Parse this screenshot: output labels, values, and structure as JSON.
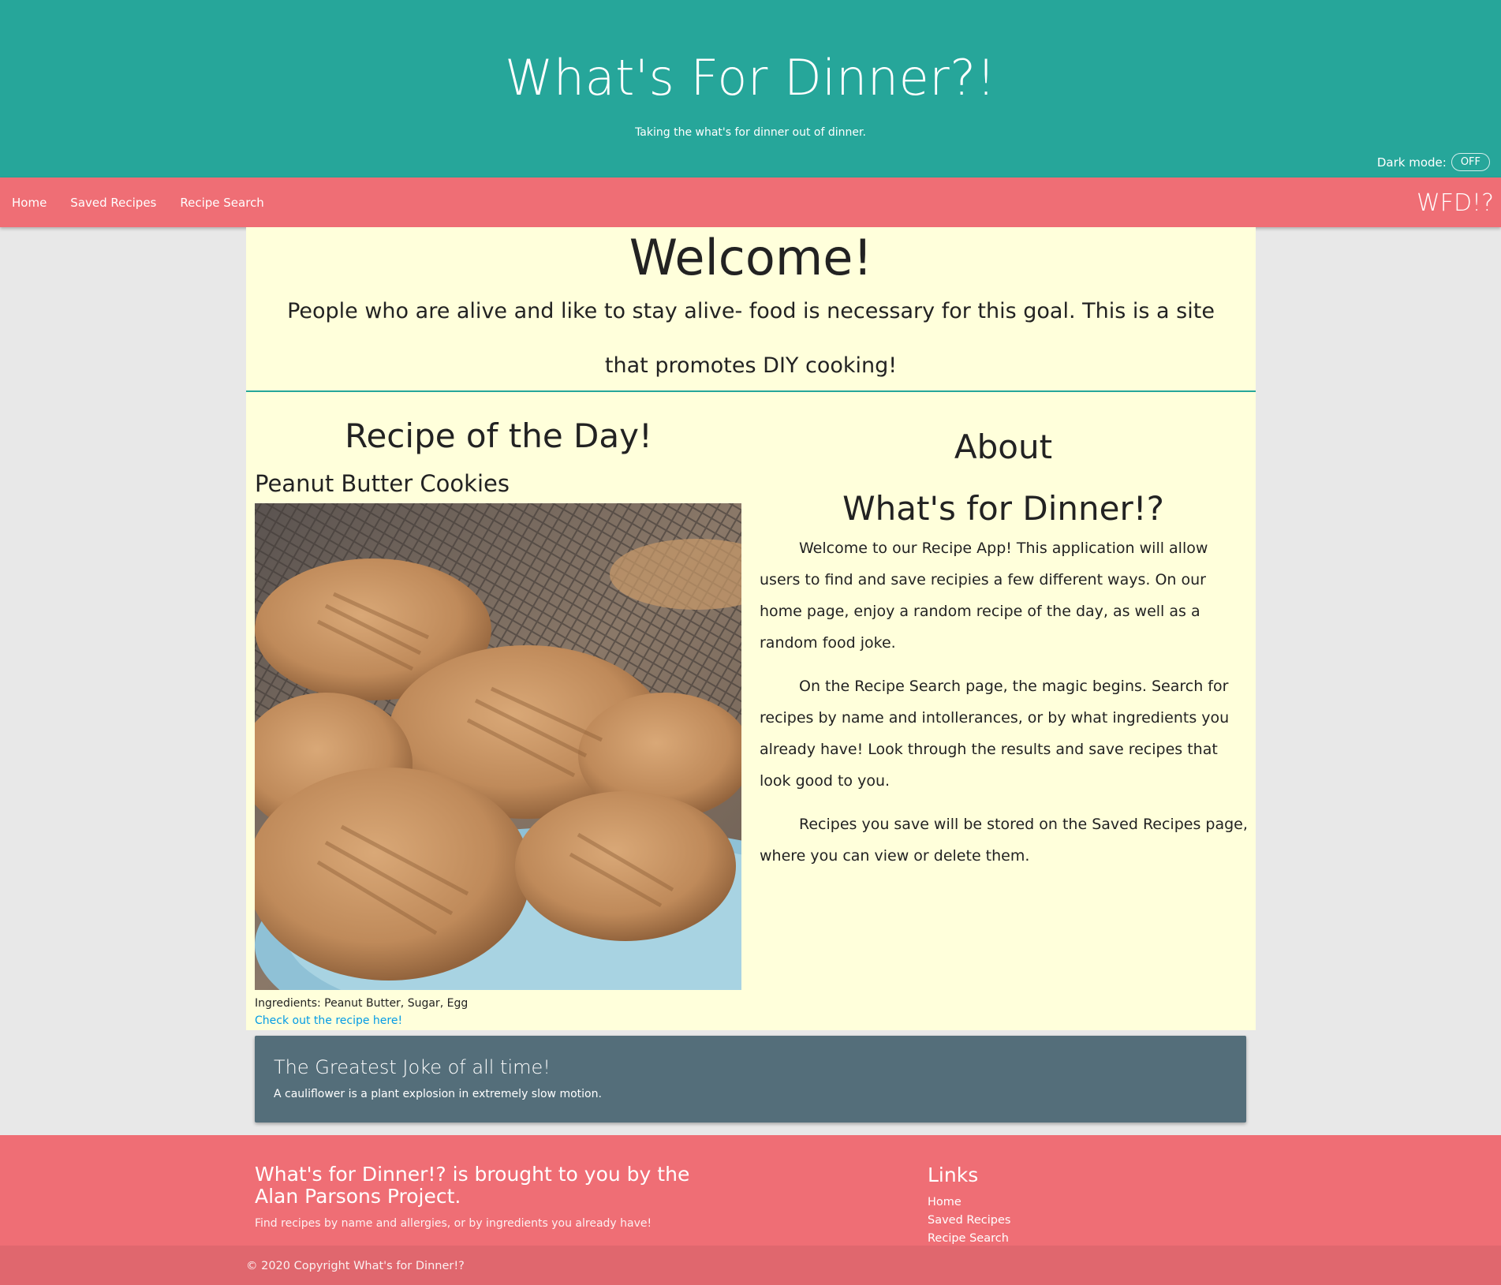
{
  "header": {
    "title": "What's For Dinner?!",
    "tagline": "Taking the what's for dinner out of dinner.",
    "dark_mode_label": "Dark mode:",
    "dark_mode_state": "OFF"
  },
  "nav": {
    "items": [
      "Home",
      "Saved Recipes",
      "Recipe Search"
    ],
    "brand": "WFD!?"
  },
  "welcome": {
    "title": "Welcome!",
    "text": "People who are alive and like to stay alive- food is necessary for this goal. This is a site that promotes DIY cooking!"
  },
  "recipe": {
    "heading": "Recipe of the Day!",
    "name": "Peanut Butter Cookies",
    "image_alt": "peanut butter cookies photo",
    "ingredients": "Ingredients: Peanut Butter, Sugar, Egg",
    "link_text": "Check out the recipe here!"
  },
  "about": {
    "title_line1": "About",
    "title_line2": "What's for Dinner!?",
    "paragraphs": [
      "Welcome to our Recipe App! This application will allow users to find and save recipies a few different ways. On our home page, enjoy a random recipe of the day, as well as a random food joke.",
      "On the Recipe Search page, the magic begins. Search for recipes by name and intollerances, or by what ingredients you already have! Look through the results and save recipes that look good to you.",
      "Recipes you save will be stored on the Saved Recipes page, where you can view or delete them."
    ]
  },
  "joke": {
    "title": "The Greatest Joke of all time!",
    "text": "A cauliflower is a plant explosion in extremely slow motion."
  },
  "footer": {
    "title": "What's for Dinner!? is brought to you by the Alan Parsons Project.",
    "subtitle": "Find recipes by name and allergies, or by ingredients you already have!",
    "links_title": "Links",
    "links": [
      "Home",
      "Saved Recipes",
      "Recipe Search"
    ],
    "copyright": "© 2020 Copyright What's for Dinner!?"
  },
  "colors": {
    "header_bg": "#26a69a",
    "nav_bg": "#ef6e75",
    "content_bg": "#ffffdb",
    "joke_bg": "#546e7a",
    "link": "#039be5"
  }
}
